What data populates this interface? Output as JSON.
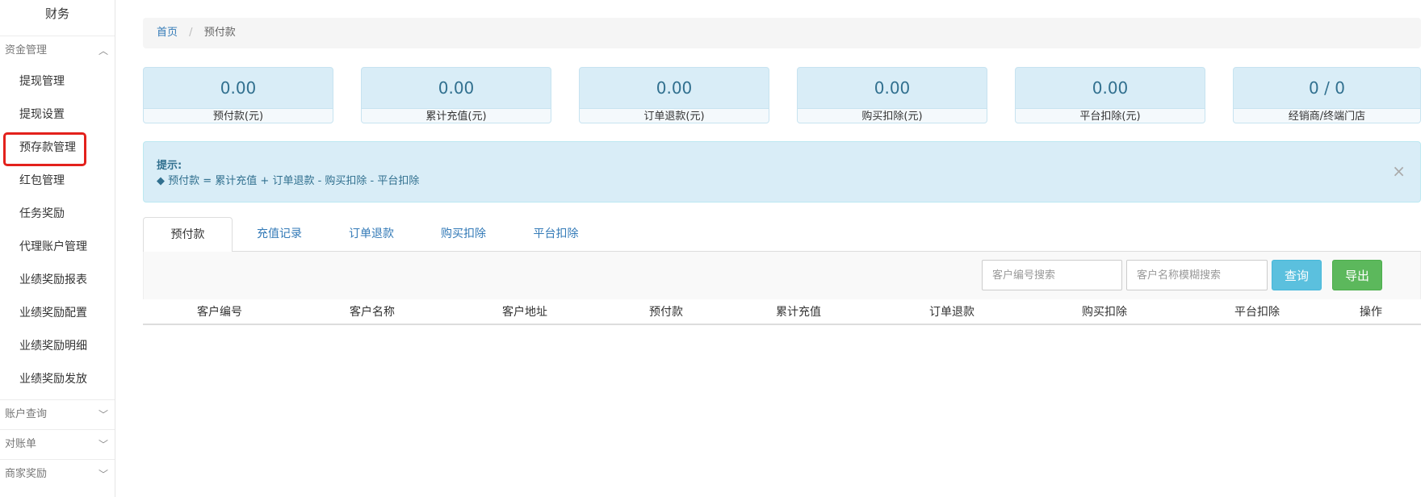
{
  "sidebar": {
    "title": "财务",
    "group_open": {
      "label": "资金管理",
      "chevron": "chevron-up-icon"
    },
    "items": [
      {
        "label": "提现管理"
      },
      {
        "label": "提现设置"
      },
      {
        "label": "预存款管理"
      },
      {
        "label": "红包管理"
      },
      {
        "label": "任务奖励"
      },
      {
        "label": "代理账户管理"
      },
      {
        "label": "业绩奖励报表"
      },
      {
        "label": "业绩奖励配置"
      },
      {
        "label": "业绩奖励明细"
      },
      {
        "label": "业绩奖励发放"
      }
    ],
    "groups_closed": [
      {
        "label": "账户查询",
        "chevron": "chevron-down-icon"
      },
      {
        "label": "对账单",
        "chevron": "chevron-down-icon"
      },
      {
        "label": "商家奖励",
        "chevron": "chevron-down-icon"
      }
    ],
    "highlight_color": "#e3211c"
  },
  "breadcrumb": {
    "home": "首页",
    "separator": "/",
    "current": "预付款"
  },
  "stats": [
    {
      "value": "0.00",
      "label": "预付款(元)"
    },
    {
      "value": "0.00",
      "label": "累计充值(元)"
    },
    {
      "value": "0.00",
      "label": "订单退款(元)"
    },
    {
      "value": "0.00",
      "label": "购买扣除(元)"
    },
    {
      "value": "0.00",
      "label": "平台扣除(元)"
    },
    {
      "value": "0 / 0",
      "label": "经销商/终端门店"
    }
  ],
  "alert": {
    "title": "提示:",
    "body": "◆ 预付款 = 累计充值 + 订单退款 - 购买扣除 - 平台扣除",
    "close": "×"
  },
  "tabs": [
    {
      "label": "预付款",
      "active": true
    },
    {
      "label": "充值记录",
      "active": false
    },
    {
      "label": "订单退款",
      "active": false
    },
    {
      "label": "购买扣除",
      "active": false
    },
    {
      "label": "平台扣除",
      "active": false
    }
  ],
  "toolbar": {
    "search_code_placeholder": "客户编号搜索",
    "search_name_placeholder": "客户名称模糊搜索",
    "query_label": "查询",
    "export_label": "导出"
  },
  "table": {
    "columns": [
      "客户编号",
      "客户名称",
      "客户地址",
      "预付款",
      "累计充值",
      "订单退款",
      "购买扣除",
      "平台扣除",
      "操作"
    ]
  },
  "colors": {
    "info_bg": "#d9edf7",
    "info_text": "#31708f",
    "link": "#337ab7",
    "query_btn": "#5bc0de",
    "export_btn": "#5cb85c"
  }
}
